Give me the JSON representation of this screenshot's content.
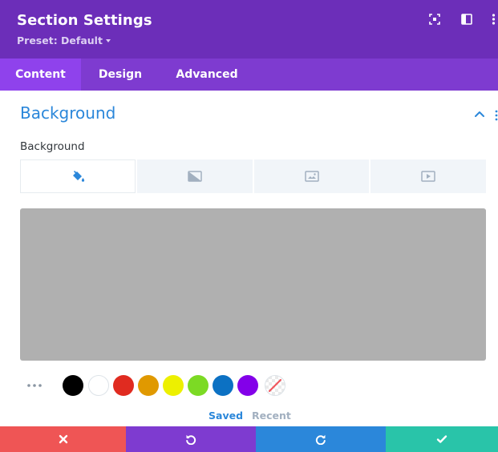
{
  "header": {
    "title": "Section Settings",
    "preset": "Preset: Default"
  },
  "tabs": [
    {
      "label": "Content",
      "active": true
    },
    {
      "label": "Design",
      "active": false
    },
    {
      "label": "Advanced",
      "active": false
    }
  ],
  "section": {
    "title": "Background",
    "field_label": "Background"
  },
  "background_types": [
    "color",
    "gradient",
    "image",
    "video"
  ],
  "preview_color": "#b0b0b0",
  "swatches": [
    "#000000",
    "#ffffff",
    "#e02b20",
    "#e09900",
    "#edf000",
    "#7cda24",
    "#0c71c3",
    "#8300e9",
    "none"
  ],
  "palette_tabs": {
    "saved": "Saved",
    "recent": "Recent"
  },
  "colors": {
    "header": "#6c2eb9",
    "tabs": "#7e3bd0",
    "tab_active": "#8f42ec",
    "accent": "#2b87da",
    "cancel": "#ef5555",
    "undo": "#7e3bd0",
    "redo": "#2b87da",
    "save": "#29c4a9"
  },
  "footer": [
    "close-icon",
    "undo-icon",
    "redo-icon",
    "check-icon"
  ]
}
